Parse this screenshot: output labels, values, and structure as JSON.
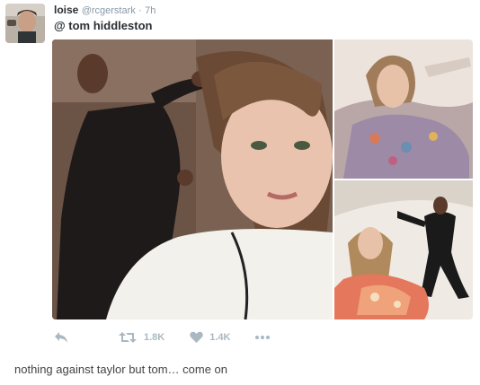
{
  "tweet": {
    "display_name": "loise",
    "handle": "@rcgerstark",
    "separator": "·",
    "time": "7h",
    "text": "@ tom hiddleston",
    "actions": {
      "reply_icon": "reply-arrow-icon",
      "retweet_icon": "retweet-arrows-icon",
      "retweet_count": "1.8K",
      "like_icon": "heart-icon",
      "like_count": "1.4K",
      "more_icon": "ellipsis-icon"
    },
    "colors": {
      "name": "#292f33",
      "meta": "#8899a6",
      "action": "#aab8c2"
    }
  },
  "post": {
    "caption": "nothing against taylor but tom… come on"
  }
}
